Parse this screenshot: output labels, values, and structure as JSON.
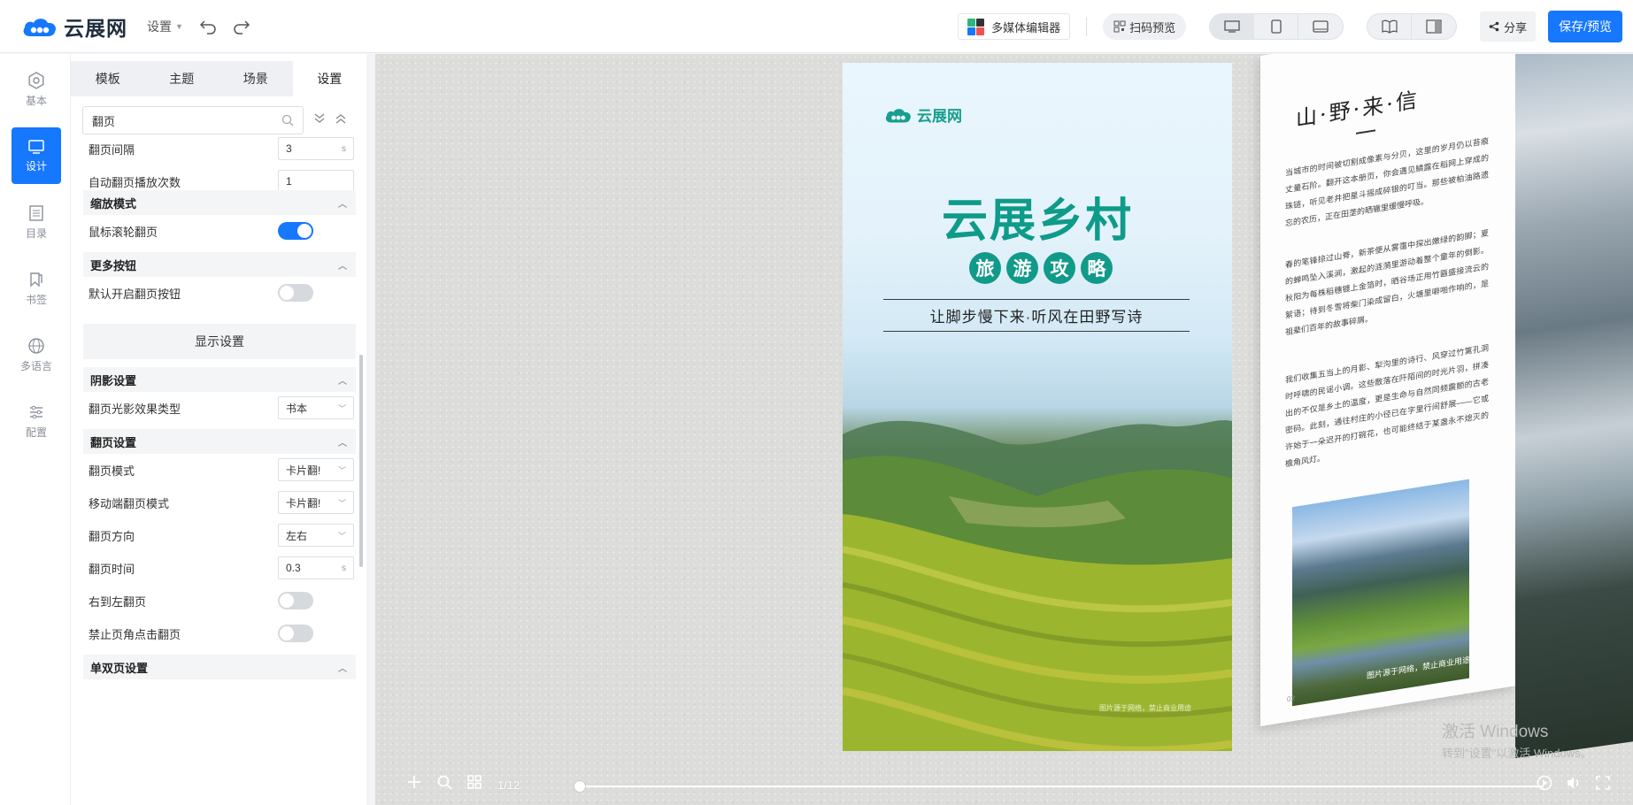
{
  "app": {
    "name": "云展网",
    "settings_menu": "设置"
  },
  "header": {
    "multimedia_editor": "多媒体编辑器",
    "scan_preview": "扫码预览",
    "share": "分享",
    "save_preview": "保存/预览"
  },
  "left_nav": [
    {
      "label": "基本",
      "icon": "gear-icon"
    },
    {
      "label": "设计",
      "icon": "monitor-icon"
    },
    {
      "label": "目录",
      "icon": "catalog-icon"
    },
    {
      "label": "书签",
      "icon": "bookmark-icon"
    },
    {
      "label": "多语言",
      "icon": "globe-icon"
    },
    {
      "label": "配置",
      "icon": "sliders-icon"
    }
  ],
  "panel": {
    "tabs": [
      "模板",
      "主题",
      "场景",
      "设置"
    ],
    "active_tab": "设置",
    "search_value": "翻页",
    "rows": {
      "flip_interval": {
        "label": "翻页间隔",
        "value": "3",
        "unit": "s"
      },
      "auto_flip_times": {
        "label": "自动翻页播放次数",
        "value": "1"
      },
      "zoom_mode": "缩放模式",
      "wheel_flip": {
        "label": "鼠标滚轮翻页",
        "on": true
      },
      "more_buttons": "更多按钮",
      "default_flip_btn": {
        "label": "默认开启翻页按钮",
        "on": false
      },
      "display_settings": "显示设置",
      "shadow_settings": "阴影设置",
      "shadow_type": {
        "label": "翻页光影效果类型",
        "value": "书本"
      },
      "flip_settings": "翻页设置",
      "flip_mode": {
        "label": "翻页模式",
        "value": "卡片翻!"
      },
      "mobile_flip_mode": {
        "label": "移动端翻页模式",
        "value": "卡片翻!"
      },
      "flip_direction": {
        "label": "翻页方向",
        "value": "左右"
      },
      "flip_time": {
        "label": "翻页时间",
        "value": "0.3",
        "unit": "s"
      },
      "rtl_flip": {
        "label": "右到左翻页",
        "on": false
      },
      "disable_corner": {
        "label": "禁止页角点击翻页",
        "on": false
      },
      "single_double": "单双页设置"
    }
  },
  "book": {
    "cover": {
      "logo": "云展网",
      "title": "云展乡村",
      "circles": [
        "旅",
        "游",
        "攻",
        "略"
      ],
      "tagline": "让脚步慢下来·听风在田野写诗",
      "note": "图片源于网络，禁止商业用途"
    },
    "page2": {
      "title": "山·野·来·信",
      "p1": "当城市的时间被切割成像素与分贝，这里的岁月仍以苔痕丈量石阶。翻开这本册页，你会遇见鳞露在稻网上穿成的珠链，听见老井把星斗摇成碎银的叮当。那些被柏油路遗忘的农历，正在田垄的晒辙里缓慢呼吸。",
      "p2": "春的笔锋掠过山脊，新茶便从雾霭中探出嫩绿的韵脚；夏的蝉鸣坠入溪涧，激起的涟漪里游动着整个童年的倒影。秋阳为每株稻穗镀上金箔时，晒谷场正用竹匾盛接流云的絮语；待到冬雪将柴门染成留白，火塘里噼啪作响的，是祖辈们百年的故事碎屑。",
      "p3": "我们收集五当上的月影、犁沟里的诗行、风穿过竹篱孔洞时呼啸的民谣小调。这些散落在阡陌间的时光片羽，拼凑出的不仅是乡土的温度，更是生命与自然同频震颤的古老密码。此刻，通往村庄的小径已在字里行间舒展——它或许始于一朵迟开的打碗花，也可能终结于某盏永不熄灭的檐角风灯。",
      "caption": "图片源于网络，禁止商业用途",
      "page_num": "02"
    }
  },
  "player": {
    "page_indicator": "1/12",
    "progress": 0.0
  },
  "watermark": {
    "line1": "激活 Windows",
    "line2": "转到\"设置\"以激活 Windows。"
  },
  "colors": {
    "accent": "#1677ff",
    "brand_teal": "#0e9b89"
  }
}
